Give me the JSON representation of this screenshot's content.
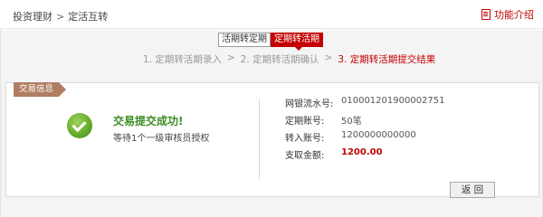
{
  "breadcrumb": {
    "parent": "投资理财",
    "separator": ">",
    "current": "定活互转"
  },
  "help": {
    "label": "功能介绍",
    "icon": "book-icon"
  },
  "tabs": [
    {
      "label": "活期转定期",
      "active": false
    },
    {
      "label": "定期转活期",
      "active": true
    }
  ],
  "steps": {
    "step1": "1. 定期转活期录入",
    "arrow": ">",
    "step2": "2. 定期转活期确认",
    "step3": "3. 定期转活期提交结果"
  },
  "panel": {
    "label": "交易信息",
    "success_title": "交易提交成功!",
    "wait_text": "等待1个一级审核员授权",
    "fields": [
      {
        "key": "网银流水号:",
        "value": "010001201900002751"
      },
      {
        "key": "定期账号:",
        "value": "50笔"
      },
      {
        "key": "转入账号:",
        "value": "1200000000000"
      },
      {
        "key": "支取金额:",
        "value": "1200.00"
      }
    ]
  },
  "back_button": "返 回",
  "colors": {
    "accent": "#c40000",
    "success": "#3c8c22",
    "label_bg": "#b07e62"
  }
}
